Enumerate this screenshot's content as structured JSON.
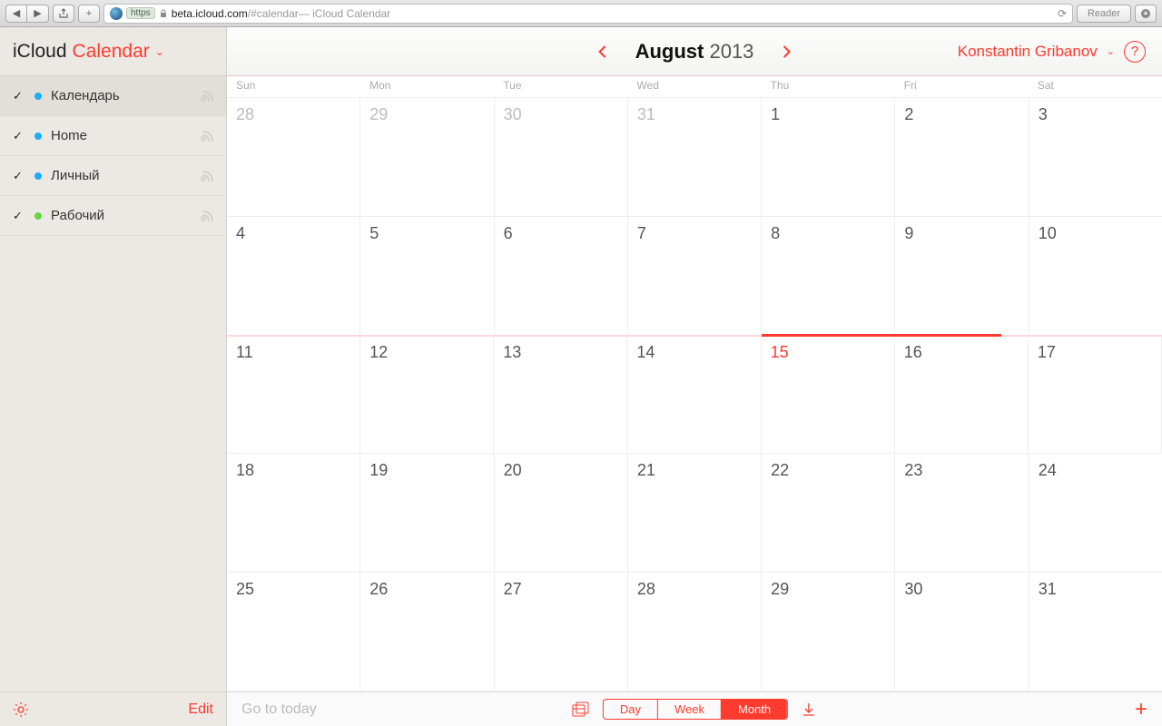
{
  "browser": {
    "url_scheme": "https",
    "url_host": "beta.icloud.com",
    "url_path": "/#calendar",
    "url_title": " — iCloud Calendar",
    "reader": "Reader"
  },
  "sidebar": {
    "app_name": "iCloud",
    "section": "Calendar",
    "edit_label": "Edit",
    "calendars": [
      {
        "name": "Календарь",
        "color": "blue",
        "checked": true,
        "selected": true
      },
      {
        "name": "Home",
        "color": "blue",
        "checked": true,
        "selected": false
      },
      {
        "name": "Личный",
        "color": "blue",
        "checked": true,
        "selected": false
      },
      {
        "name": "Рабочий",
        "color": "green",
        "checked": true,
        "selected": false
      }
    ]
  },
  "header": {
    "month": "August",
    "year": "2013",
    "user": "Konstantin Gribanov",
    "help": "?"
  },
  "days_of_week": [
    "Sun",
    "Mon",
    "Tue",
    "Wed",
    "Thu",
    "Fri",
    "Sat"
  ],
  "weeks": [
    [
      {
        "n": "28",
        "other": true
      },
      {
        "n": "29",
        "other": true
      },
      {
        "n": "30",
        "other": true
      },
      {
        "n": "31",
        "other": true
      },
      {
        "n": "1"
      },
      {
        "n": "2"
      },
      {
        "n": "3"
      }
    ],
    [
      {
        "n": "4"
      },
      {
        "n": "5"
      },
      {
        "n": "6"
      },
      {
        "n": "7"
      },
      {
        "n": "8"
      },
      {
        "n": "9"
      },
      {
        "n": "10"
      }
    ],
    [
      {
        "n": "11"
      },
      {
        "n": "12"
      },
      {
        "n": "13"
      },
      {
        "n": "14"
      },
      {
        "n": "15",
        "today": true
      },
      {
        "n": "16"
      },
      {
        "n": "17"
      }
    ],
    [
      {
        "n": "18"
      },
      {
        "n": "19"
      },
      {
        "n": "20"
      },
      {
        "n": "21"
      },
      {
        "n": "22"
      },
      {
        "n": "23"
      },
      {
        "n": "24"
      }
    ],
    [
      {
        "n": "25"
      },
      {
        "n": "26"
      },
      {
        "n": "27"
      },
      {
        "n": "28"
      },
      {
        "n": "29"
      },
      {
        "n": "30"
      },
      {
        "n": "31"
      }
    ]
  ],
  "footer": {
    "goto_today": "Go to today",
    "views": [
      "Day",
      "Week",
      "Month"
    ],
    "active_view": 2
  }
}
